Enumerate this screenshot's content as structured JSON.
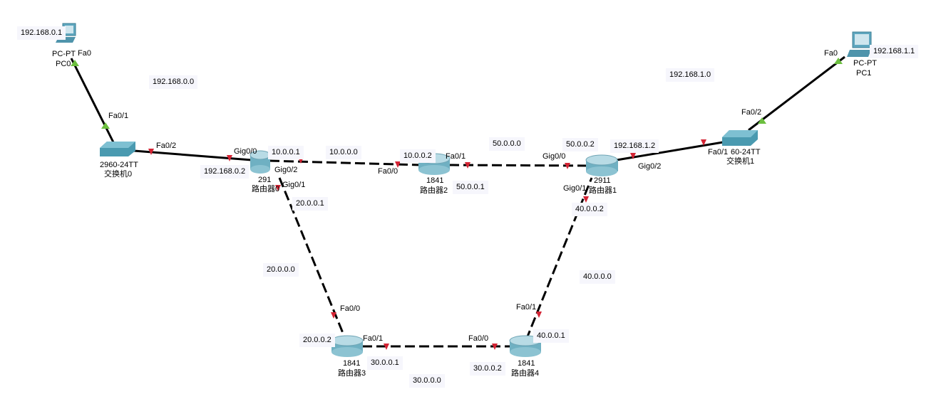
{
  "colors": {
    "link": "#000000",
    "port_up": "#6cbf3f",
    "port_down": "#d42434",
    "device": "#4a9ab0",
    "label_bg": "#f6f6fc"
  },
  "devices": {
    "pc0": {
      "model": "PC-PT",
      "name": "PC0",
      "ip": "192.168.0.1",
      "port": "Fa0"
    },
    "switch0": {
      "model": "2960-24TT",
      "name": "交换机0",
      "port1": "Fa0/1",
      "port2": "Fa0/2"
    },
    "router0": {
      "model": "291",
      "name": "路由器0",
      "gig00": "Gig0/0",
      "gig01": "Gig0/1",
      "gig02": "Gig0/2",
      "ip_g00": "192.168.0.2",
      "ip_g02": "10.0.0.1",
      "ip_g01": "20.0.0.1"
    },
    "router2": {
      "model": "1841",
      "name": "路由器2",
      "fa00": "Fa0/0",
      "fa01": "Fa0/1",
      "ip_fa00": "10.0.0.2",
      "ip_fa01": "50.0.0.1"
    },
    "router1": {
      "model": "2911",
      "name": "路由器1",
      "gig00": "Gig0/0",
      "gig01": "Gig0/1",
      "gig02": "Gig0/2",
      "ip_g00": "50.0.0.2",
      "ip_g02": "192.168.1.2",
      "ip_g01": "40.0.0.2"
    },
    "switch1": {
      "model": "60-24TT",
      "name": "交换机1",
      "port1": "Fa0/1",
      "port2": "Fa0/2"
    },
    "pc1": {
      "model": "PC-PT",
      "name": "PC1",
      "ip": "192.168.1.1",
      "port": "Fa0"
    },
    "router3": {
      "model": "1841",
      "name": "路由器3",
      "fa00": "Fa0/0",
      "fa01": "Fa0/1",
      "ip_fa00": "20.0.0.2",
      "ip_fa01": "30.0.0.1"
    },
    "router4": {
      "model": "1841",
      "name": "路由器4",
      "fa00": "Fa0/0",
      "fa01": "Fa0/1",
      "ip_fa00": "30.0.0.2",
      "ip_fa01": "40.0.0.1"
    }
  },
  "networks": {
    "lan0": "192.168.0.0",
    "lan1": "192.168.1.0",
    "n10": "10.0.0.0",
    "n20": "20.0.0.0",
    "n30": "30.0.0.0",
    "n40": "40.0.0.0",
    "n50": "50.0.0.0"
  }
}
